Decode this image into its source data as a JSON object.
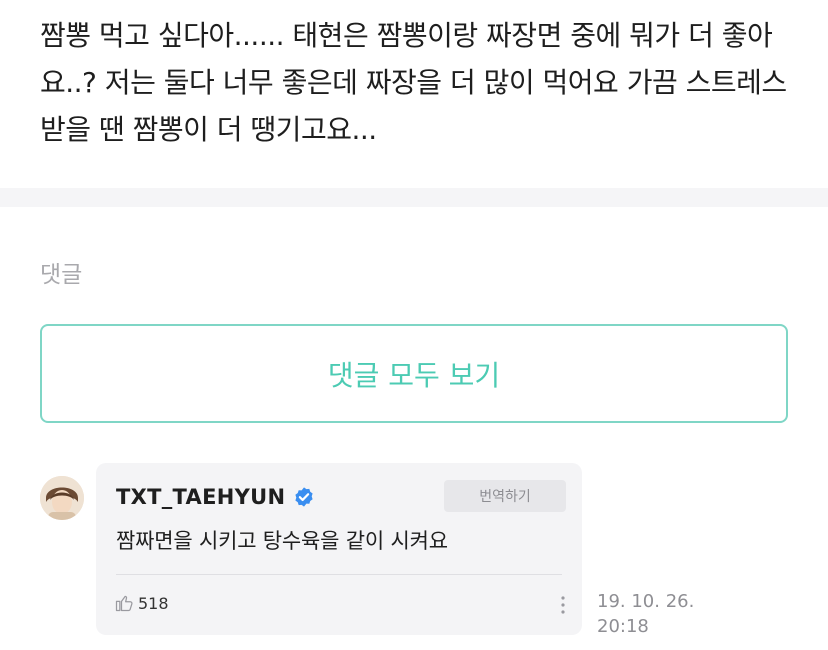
{
  "post": {
    "body": "짬뽕 먹고 싶다아...... 태현은 짬뽕이랑 짜장면 중에 뭐가 더 좋아요..? 저는 둘다 너무 좋은데 짜장을 더 많이 먹어요 가끔 스트레스 받을 땐 짬뽕이 더 땡기고요..."
  },
  "comments": {
    "heading": "댓글",
    "view_all_label": "댓글 모두 보기",
    "items": [
      {
        "author": "TXT_TAEHYUN",
        "verified_icon": "verified-badge-icon",
        "translate_label": "번역하기",
        "text": "짬짜면을 시키고 탕수육을 같이 시켜요",
        "likes": "518",
        "date": "19. 10. 26.",
        "time": "20:18"
      }
    ]
  },
  "colors": {
    "accent": "#4ccbb3",
    "accent_border": "#7fd6c6",
    "verified": "#3a8ef0",
    "bubble_bg": "#f4f4f6",
    "muted_text": "#a9a9ad"
  }
}
